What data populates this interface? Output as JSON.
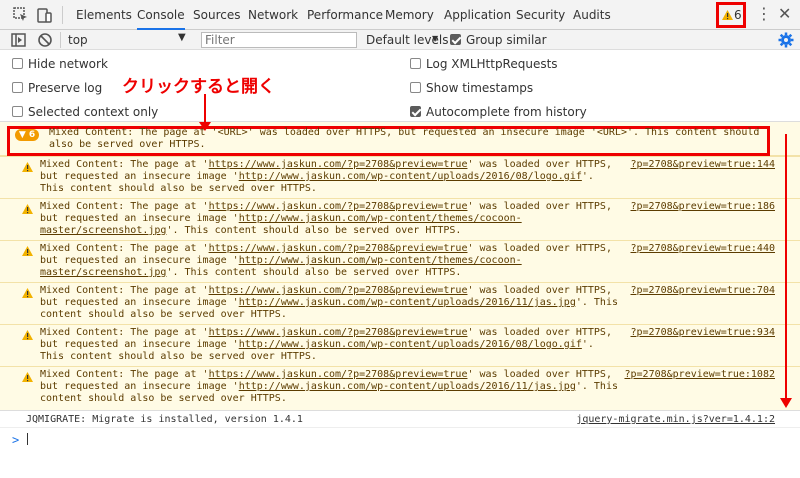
{
  "tabs": [
    {
      "label": "Elements"
    },
    {
      "label": "Console"
    },
    {
      "label": "Sources"
    },
    {
      "label": "Network"
    },
    {
      "label": "Performance"
    },
    {
      "label": "Memory"
    },
    {
      "label": "Application"
    },
    {
      "label": "Security"
    },
    {
      "label": "Audits"
    }
  ],
  "active_tab": "Console",
  "warning_count": "6",
  "toolbar": {
    "context": "top",
    "filter_placeholder": "Filter",
    "levels": "Default levels",
    "group_similar": "Group similar",
    "group_similar_checked": true
  },
  "settings": {
    "hide_network": "Hide network",
    "preserve_log": "Preserve log",
    "selected_context_only": "Selected context only",
    "log_xhr": "Log XMLHttpRequests",
    "show_timestamps": "Show timestamps",
    "autocomplete": "Autocomplete from history",
    "autocomplete_checked": true
  },
  "annotation": "クリックすると開く",
  "group": {
    "count": "6",
    "text": "Mixed Content: The page at '<URL>' was loaded over HTTPS, but requested an insecure image '<URL>'. This content should also be served over HTTPS."
  },
  "entries": [
    {
      "page": "https://www.jaskun.com/?p=2708&preview=true",
      "image": "http://www.jaskun.com/wp-content/uploads/2016/08/logo.gif",
      "source": "?p=2708&preview=true:144"
    },
    {
      "page": "https://www.jaskun.com/?p=2708&preview=true",
      "image": "http://www.jaskun.com/wp-content/themes/cocoon-master/screenshot.jpg",
      "source": "?p=2708&preview=true:186"
    },
    {
      "page": "https://www.jaskun.com/?p=2708&preview=true",
      "image": "http://www.jaskun.com/wp-content/themes/cocoon-master/screenshot.jpg",
      "source": "?p=2708&preview=true:440"
    },
    {
      "page": "https://www.jaskun.com/?p=2708&preview=true",
      "image": "http://www.jaskun.com/wp-content/uploads/2016/11/jas.jpg",
      "source": "?p=2708&preview=true:704"
    },
    {
      "page": "https://www.jaskun.com/?p=2708&preview=true",
      "image": "http://www.jaskun.com/wp-content/uploads/2016/08/logo.gif",
      "source": "?p=2708&preview=true:934"
    },
    {
      "page": "https://www.jaskun.com/?p=2708&preview=true",
      "image": "http://www.jaskun.com/wp-content/uploads/2016/11/jas.jpg",
      "source": "?p=2708&preview=true:1082"
    }
  ],
  "info": {
    "text": "JQMIGRATE: Migrate is installed, version 1.4.1",
    "source": "jquery-migrate.min.js?ver=1.4.1:2"
  },
  "prompt": ">",
  "colors": {
    "accent": "#1a73e8",
    "warning_bg": "#fffbe5",
    "warning_text": "#5c3c00",
    "highlight": "#e00000"
  }
}
